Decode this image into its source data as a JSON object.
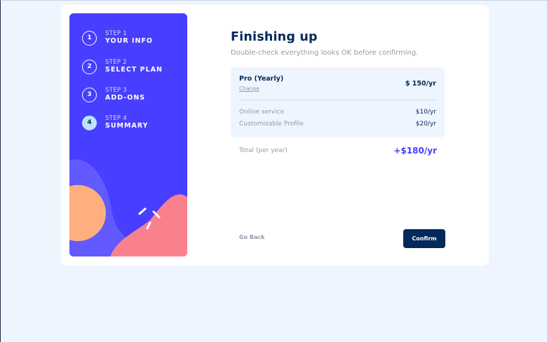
{
  "sidebar": {
    "steps": [
      {
        "number": "1",
        "label": "STEP 1",
        "title": "YOUR INFO",
        "active": false
      },
      {
        "number": "2",
        "label": "STEP 2",
        "title": "SELECT PLAN",
        "active": false
      },
      {
        "number": "3",
        "label": "STEP 3",
        "title": "ADD-ONS",
        "active": false
      },
      {
        "number": "4",
        "label": "STEP 4",
        "title": "SUMMARY",
        "active": true
      }
    ]
  },
  "main": {
    "title": "Finishing up",
    "subtitle": "Double-check everything looks OK before confirming.",
    "plan": {
      "name": "Pro (Yearly)",
      "change_label": "Change",
      "price": "$ 150/yr"
    },
    "addons": [
      {
        "name": "Online service",
        "price": "$10/yr"
      },
      {
        "name": "Customizable Profile",
        "price": "$20/yr"
      }
    ],
    "total": {
      "label": "Total (per year)",
      "price": "+$180/yr"
    },
    "back_label": "Go Back",
    "confirm_label": "Confirm"
  },
  "colors": {
    "sidebar_bg": "#483eff",
    "accent": "#483eff",
    "marine_blue": "#02295a",
    "active_step": "#bee2fd",
    "page_bg": "#eff5ff"
  }
}
